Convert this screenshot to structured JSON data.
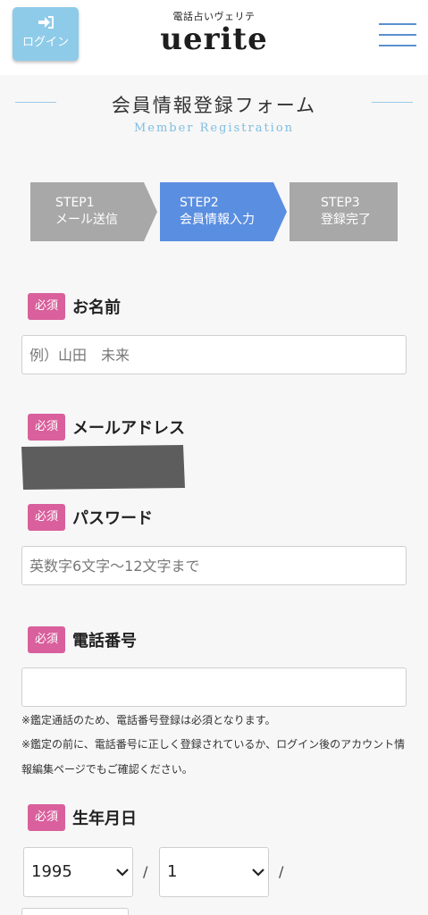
{
  "header": {
    "login_label": "ログイン",
    "logo_sub": "電話占いヴェリテ",
    "logo_main": "uerite"
  },
  "title": {
    "jp": "会員情報登録フォーム",
    "en": "Member Registration"
  },
  "steps": [
    {
      "num": "STEP1",
      "label": "メール送信",
      "active": false
    },
    {
      "num": "STEP2",
      "label": "会員情報入力",
      "active": true
    },
    {
      "num": "STEP3",
      "label": "登録完了",
      "active": false
    }
  ],
  "form": {
    "required_badge": "必須",
    "name": {
      "label": "お名前",
      "placeholder": "例）山田　未来"
    },
    "email": {
      "label": "メールアドレス"
    },
    "password": {
      "label": "パスワード",
      "placeholder": "英数字6文字〜12文字まで"
    },
    "phone": {
      "label": "電話番号",
      "value": "",
      "note1": "※鑑定通話のため、電話番号登録は必須となります。",
      "note2": "※鑑定の前に、電話番号に正しく登録されているか、ログイン後のアカウント情報編集ページでもご確認ください。"
    },
    "birthdate": {
      "label": "生年月日",
      "year": "1995",
      "month": "1",
      "separator": "/"
    }
  },
  "colors": {
    "accent_blue": "#5a8ee0",
    "required_pink": "#d9609c",
    "login_button": "#8ecbe9",
    "step_inactive": "#a8a8a8"
  }
}
